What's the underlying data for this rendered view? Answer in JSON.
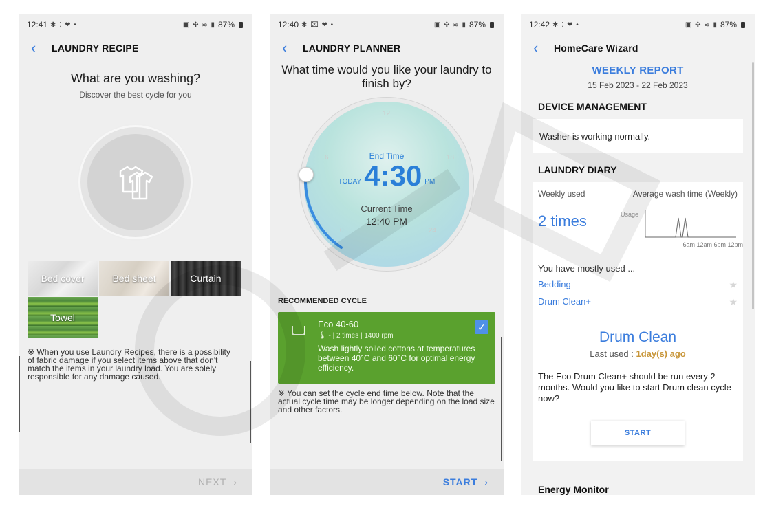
{
  "phone1": {
    "status": {
      "time": "12:41",
      "battery": "87%"
    },
    "title": "LAUNDRY RECIPE",
    "heading": "What are you washing?",
    "subheading": "Discover the best cycle for you",
    "tiles": [
      {
        "label": "Bed cover"
      },
      {
        "label": "Bed sheet"
      },
      {
        "label": "Curtain"
      },
      {
        "label": "Towel"
      }
    ],
    "notice": "※ When you use Laundry Recipes, there is a possibility of fabric damage if you select items above that don't match the items in your laundry load. You are solely responsible for any damage caused.",
    "next_label": "NEXT"
  },
  "phone2": {
    "status": {
      "time": "12:40",
      "battery": "87%"
    },
    "title": "LAUNDRY PLANNER",
    "heading": "What time would you like your laundry to finish by?",
    "dial": {
      "hour_12": "12",
      "hour_6": "6",
      "hour_18": "18",
      "hour_0": "0",
      "hour_24": "24",
      "end_label": "End Time",
      "today": "TODAY",
      "end_time": "4:30",
      "pm": "PM",
      "current_label": "Current Time",
      "current_time": "12:40 PM"
    },
    "recommended_title": "RECOMMENDED CYCLE",
    "cycle": {
      "name": "Eco 40-60",
      "meta": "🌡 - | 2 times | 1400 rpm",
      "description": "Wash lightly soiled cottons at temperatures between 40°C and 60°C for optimal energy efficiency.",
      "checked": true
    },
    "notice": "※ You can set the cycle end time below. Note that the actual cycle time may be longer depending on the load size and other factors.",
    "start_label": "START"
  },
  "phone3": {
    "status": {
      "time": "12:42",
      "battery": "87%"
    },
    "title": "HomeCare Wizard",
    "report_title": "WEEKLY REPORT",
    "report_dates": "15 Feb 2023 - 22 Feb 2023",
    "device_section": "DEVICE MANAGEMENT",
    "device_status": "Washer is working normally.",
    "diary_section": "LAUNDRY DIARY",
    "weekly_used_label": "Weekly used",
    "avg_wash_label": "Average wash time (Weekly)",
    "weekly_used_value": "2 times",
    "usage_label": "Usage",
    "usage_ticks": "6am 12am 6pm 12pm",
    "mostly_used_label": "You have mostly used ...",
    "mostly_used": [
      {
        "label": "Bedding"
      },
      {
        "label": "Drum Clean+"
      }
    ],
    "drum_title": "Drum Clean",
    "drum_last_label": "Last used : ",
    "drum_last_value": "1day(s) ago",
    "drum_text": "The Eco Drum Clean+ should be run every 2 months. Would you like to start Drum clean cycle now?",
    "start_label": "START",
    "energy_section": "Energy Monitor"
  },
  "colors": {
    "accent": "#3b7ddd",
    "cycle_green": "#5aa12e",
    "last_used": "#c8963a"
  }
}
